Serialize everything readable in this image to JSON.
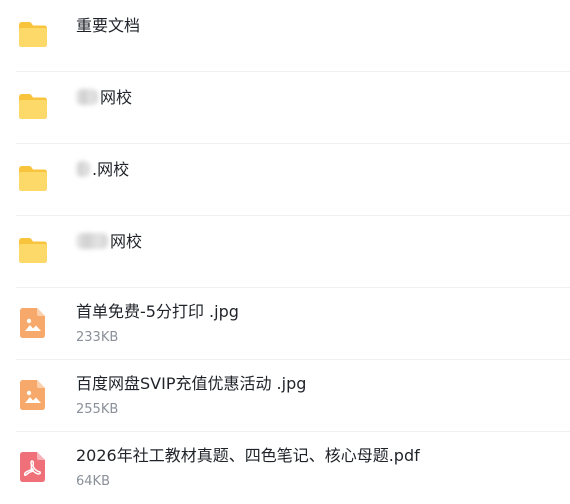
{
  "items": [
    {
      "type": "folder",
      "name": "重要文档"
    },
    {
      "type": "folder",
      "name": "网校"
    },
    {
      "type": "folder",
      "name": ".网校"
    },
    {
      "type": "folder",
      "name": "网校"
    },
    {
      "type": "image",
      "name": "首单免费-5分打印 .jpg",
      "size": "233KB"
    },
    {
      "type": "image",
      "name": "百度网盘SVIP充值优惠活动 .jpg",
      "size": "255KB"
    },
    {
      "type": "pdf",
      "name": "2026年社工教材真题、四色笔记、核心母题.pdf",
      "size": "64KB"
    }
  ],
  "colors": {
    "folder": "#fbcf4e",
    "image_icon": "#f6a96a",
    "pdf_icon": "#f0707a",
    "divider": "#eef0f3",
    "size_text": "#8a9099"
  },
  "icons": {
    "folder": "folder-icon",
    "image": "image-file-icon",
    "pdf": "pdf-file-icon"
  }
}
